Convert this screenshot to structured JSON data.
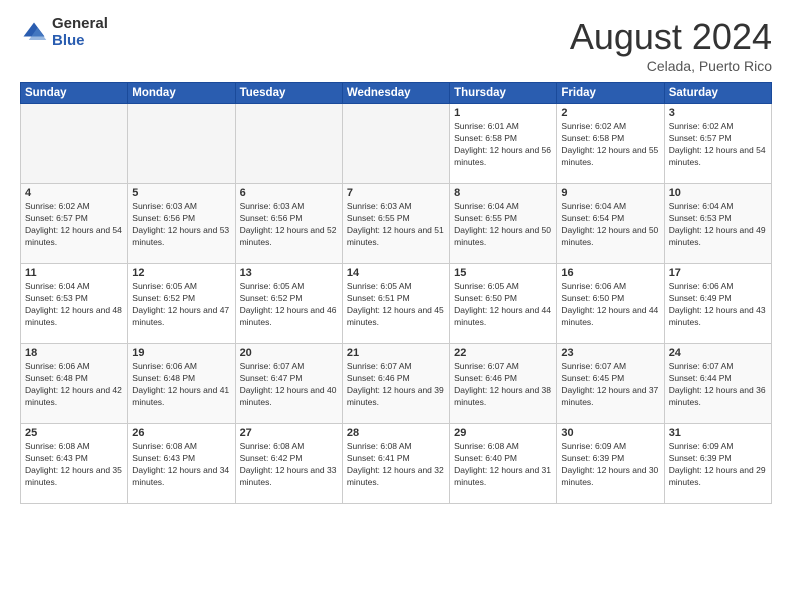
{
  "header": {
    "logo_general": "General",
    "logo_blue": "Blue",
    "month": "August 2024",
    "location": "Celada, Puerto Rico"
  },
  "weekdays": [
    "Sunday",
    "Monday",
    "Tuesday",
    "Wednesday",
    "Thursday",
    "Friday",
    "Saturday"
  ],
  "weeks": [
    [
      {
        "day": "",
        "empty": true
      },
      {
        "day": "",
        "empty": true
      },
      {
        "day": "",
        "empty": true
      },
      {
        "day": "",
        "empty": true
      },
      {
        "day": "1",
        "sunrise": "Sunrise: 6:01 AM",
        "sunset": "Sunset: 6:58 PM",
        "daylight": "Daylight: 12 hours and 56 minutes."
      },
      {
        "day": "2",
        "sunrise": "Sunrise: 6:02 AM",
        "sunset": "Sunset: 6:58 PM",
        "daylight": "Daylight: 12 hours and 55 minutes."
      },
      {
        "day": "3",
        "sunrise": "Sunrise: 6:02 AM",
        "sunset": "Sunset: 6:57 PM",
        "daylight": "Daylight: 12 hours and 54 minutes."
      }
    ],
    [
      {
        "day": "4",
        "sunrise": "Sunrise: 6:02 AM",
        "sunset": "Sunset: 6:57 PM",
        "daylight": "Daylight: 12 hours and 54 minutes."
      },
      {
        "day": "5",
        "sunrise": "Sunrise: 6:03 AM",
        "sunset": "Sunset: 6:56 PM",
        "daylight": "Daylight: 12 hours and 53 minutes."
      },
      {
        "day": "6",
        "sunrise": "Sunrise: 6:03 AM",
        "sunset": "Sunset: 6:56 PM",
        "daylight": "Daylight: 12 hours and 52 minutes."
      },
      {
        "day": "7",
        "sunrise": "Sunrise: 6:03 AM",
        "sunset": "Sunset: 6:55 PM",
        "daylight": "Daylight: 12 hours and 51 minutes."
      },
      {
        "day": "8",
        "sunrise": "Sunrise: 6:04 AM",
        "sunset": "Sunset: 6:55 PM",
        "daylight": "Daylight: 12 hours and 50 minutes."
      },
      {
        "day": "9",
        "sunrise": "Sunrise: 6:04 AM",
        "sunset": "Sunset: 6:54 PM",
        "daylight": "Daylight: 12 hours and 50 minutes."
      },
      {
        "day": "10",
        "sunrise": "Sunrise: 6:04 AM",
        "sunset": "Sunset: 6:53 PM",
        "daylight": "Daylight: 12 hours and 49 minutes."
      }
    ],
    [
      {
        "day": "11",
        "sunrise": "Sunrise: 6:04 AM",
        "sunset": "Sunset: 6:53 PM",
        "daylight": "Daylight: 12 hours and 48 minutes."
      },
      {
        "day": "12",
        "sunrise": "Sunrise: 6:05 AM",
        "sunset": "Sunset: 6:52 PM",
        "daylight": "Daylight: 12 hours and 47 minutes."
      },
      {
        "day": "13",
        "sunrise": "Sunrise: 6:05 AM",
        "sunset": "Sunset: 6:52 PM",
        "daylight": "Daylight: 12 hours and 46 minutes."
      },
      {
        "day": "14",
        "sunrise": "Sunrise: 6:05 AM",
        "sunset": "Sunset: 6:51 PM",
        "daylight": "Daylight: 12 hours and 45 minutes."
      },
      {
        "day": "15",
        "sunrise": "Sunrise: 6:05 AM",
        "sunset": "Sunset: 6:50 PM",
        "daylight": "Daylight: 12 hours and 44 minutes."
      },
      {
        "day": "16",
        "sunrise": "Sunrise: 6:06 AM",
        "sunset": "Sunset: 6:50 PM",
        "daylight": "Daylight: 12 hours and 44 minutes."
      },
      {
        "day": "17",
        "sunrise": "Sunrise: 6:06 AM",
        "sunset": "Sunset: 6:49 PM",
        "daylight": "Daylight: 12 hours and 43 minutes."
      }
    ],
    [
      {
        "day": "18",
        "sunrise": "Sunrise: 6:06 AM",
        "sunset": "Sunset: 6:48 PM",
        "daylight": "Daylight: 12 hours and 42 minutes."
      },
      {
        "day": "19",
        "sunrise": "Sunrise: 6:06 AM",
        "sunset": "Sunset: 6:48 PM",
        "daylight": "Daylight: 12 hours and 41 minutes."
      },
      {
        "day": "20",
        "sunrise": "Sunrise: 6:07 AM",
        "sunset": "Sunset: 6:47 PM",
        "daylight": "Daylight: 12 hours and 40 minutes."
      },
      {
        "day": "21",
        "sunrise": "Sunrise: 6:07 AM",
        "sunset": "Sunset: 6:46 PM",
        "daylight": "Daylight: 12 hours and 39 minutes."
      },
      {
        "day": "22",
        "sunrise": "Sunrise: 6:07 AM",
        "sunset": "Sunset: 6:46 PM",
        "daylight": "Daylight: 12 hours and 38 minutes."
      },
      {
        "day": "23",
        "sunrise": "Sunrise: 6:07 AM",
        "sunset": "Sunset: 6:45 PM",
        "daylight": "Daylight: 12 hours and 37 minutes."
      },
      {
        "day": "24",
        "sunrise": "Sunrise: 6:07 AM",
        "sunset": "Sunset: 6:44 PM",
        "daylight": "Daylight: 12 hours and 36 minutes."
      }
    ],
    [
      {
        "day": "25",
        "sunrise": "Sunrise: 6:08 AM",
        "sunset": "Sunset: 6:43 PM",
        "daylight": "Daylight: 12 hours and 35 minutes."
      },
      {
        "day": "26",
        "sunrise": "Sunrise: 6:08 AM",
        "sunset": "Sunset: 6:43 PM",
        "daylight": "Daylight: 12 hours and 34 minutes."
      },
      {
        "day": "27",
        "sunrise": "Sunrise: 6:08 AM",
        "sunset": "Sunset: 6:42 PM",
        "daylight": "Daylight: 12 hours and 33 minutes."
      },
      {
        "day": "28",
        "sunrise": "Sunrise: 6:08 AM",
        "sunset": "Sunset: 6:41 PM",
        "daylight": "Daylight: 12 hours and 32 minutes."
      },
      {
        "day": "29",
        "sunrise": "Sunrise: 6:08 AM",
        "sunset": "Sunset: 6:40 PM",
        "daylight": "Daylight: 12 hours and 31 minutes."
      },
      {
        "day": "30",
        "sunrise": "Sunrise: 6:09 AM",
        "sunset": "Sunset: 6:39 PM",
        "daylight": "Daylight: 12 hours and 30 minutes."
      },
      {
        "day": "31",
        "sunrise": "Sunrise: 6:09 AM",
        "sunset": "Sunset: 6:39 PM",
        "daylight": "Daylight: 12 hours and 29 minutes."
      }
    ]
  ]
}
